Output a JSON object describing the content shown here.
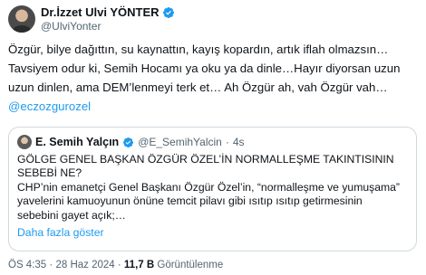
{
  "author": {
    "name": "Dr.İzzet Ulvi YÖNTER",
    "handle": "@UlviYonter"
  },
  "tweet": {
    "lines": [
      "Özgür, bilye dağıttın, su kaynattın, kayış kopardın, artık iflah olmazsın…",
      "Tavsiyem odur ki, Semih Hocamı ya oku ya da dinle…Hayır diyorsan uzun",
      "uzun dinlen, ama DEM’lenmeyi terk et… Ah Özgür ah, vah Özgür vah…"
    ],
    "mention": "@eczozgurozel"
  },
  "quoted": {
    "name": "E. Semih Yalçın",
    "handle": "@E_SemihYalcin",
    "separator": "·",
    "time": "4s",
    "lines": [
      "GÖLGE GENEL BAŞKAN ÖZGÜR ÖZEL’İN NORMALLEŞME TAKINTISININ",
      "SEBEBİ NE?",
      "CHP’nin emanetçi Genel Başkanı Özgür Özel’in, “normalleşme ve yumuşama”",
      "yavelerini kamuoyunun önüne temcit pilavı gibi ısıtıp ısıtıp getirmesinin",
      "sebebini gayet açık;…"
    ],
    "show_more": "Daha fazla göster"
  },
  "footer": {
    "time": "ÖS 4:35",
    "dot": "·",
    "date": "28 Haz 2024",
    "views_count": "11,7 B",
    "views_label": "Görüntülenme"
  },
  "colors": {
    "accent": "#1d9bf0",
    "muted": "#536471",
    "border": "#cfd9de"
  }
}
